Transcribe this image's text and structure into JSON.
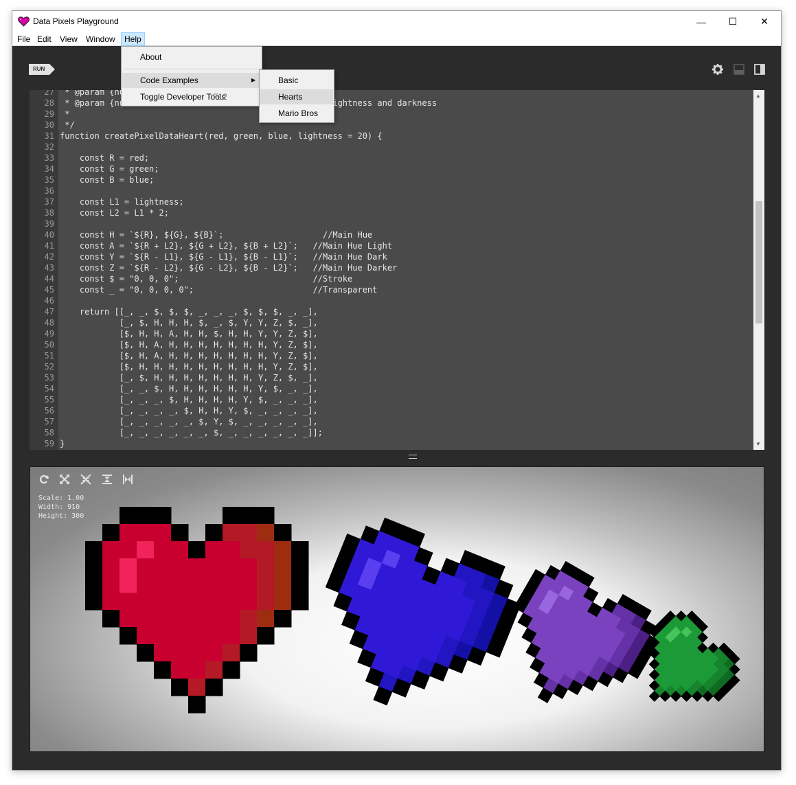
{
  "window": {
    "title": "Data Pixels Playground",
    "minimize": "—",
    "maximize": "☐",
    "close": "✕"
  },
  "menu": [
    {
      "label": "File"
    },
    {
      "label": "Edit"
    },
    {
      "label": "View"
    },
    {
      "label": "Window"
    },
    {
      "label": "Help"
    }
  ],
  "help_menu": {
    "about": "About",
    "code_examples": "Code Examples",
    "toggle_devtools": "Toggle Developer Tools",
    "devtools_shortcut": "F12"
  },
  "examples_submenu": [
    {
      "label": "Basic"
    },
    {
      "label": "Hearts"
    },
    {
      "label": "Mario Bros"
    }
  ],
  "toolbar": {
    "run_label": "RUN",
    "icons": [
      "run-icon",
      "gear-icon",
      "horizontal-layout-icon",
      "vertical-layout-icon"
    ]
  },
  "editor": {
    "lines": [
      {
        "n": "27",
        "text": " * @param {number} ...                           "
      },
      {
        "n": "28",
        "text": " * @param {nu                                    for brightness and darkness"
      },
      {
        "n": "29",
        "text": " *"
      },
      {
        "n": "30",
        "text": " */"
      },
      {
        "n": "31",
        "text": "function createPixelDataHeart(red, green, blue, lightness = 20) {"
      },
      {
        "n": "32",
        "text": ""
      },
      {
        "n": "33",
        "text": "    const R = red;"
      },
      {
        "n": "34",
        "text": "    const G = green;"
      },
      {
        "n": "35",
        "text": "    const B = blue;"
      },
      {
        "n": "36",
        "text": ""
      },
      {
        "n": "37",
        "text": "    const L1 = lightness;"
      },
      {
        "n": "38",
        "text": "    const L2 = L1 * 2;"
      },
      {
        "n": "39",
        "text": ""
      },
      {
        "n": "40",
        "text": "    const H = `${R}, ${G}, ${B}`;                    //Main Hue"
      },
      {
        "n": "41",
        "text": "    const A = `${R + L2}, ${G + L2}, ${B + L2}`;   //Main Hue Light"
      },
      {
        "n": "42",
        "text": "    const Y = `${R - L1}, ${G - L1}, ${B - L1}`;   //Main Hue Dark"
      },
      {
        "n": "43",
        "text": "    const Z = `${R - L2}, ${G - L2}, ${B - L2}`;   //Main Hue Darker"
      },
      {
        "n": "44",
        "text": "    const $ = \"0, 0, 0\";                           //Stroke"
      },
      {
        "n": "45",
        "text": "    const _ = \"0, 0, 0, 0\";                        //Transparent"
      },
      {
        "n": "46",
        "text": ""
      },
      {
        "n": "47",
        "text": "    return [[_, _, $, $, $, _, _, _, $, $, $, _, _],"
      },
      {
        "n": "48",
        "text": "            [_, $, H, H, H, $, _, $, Y, Y, Z, $, _],"
      },
      {
        "n": "49",
        "text": "            [$, H, H, A, H, H, $, H, H, Y, Y, Z, $],"
      },
      {
        "n": "50",
        "text": "            [$, H, A, H, H, H, H, H, H, H, Y, Z, $],"
      },
      {
        "n": "51",
        "text": "            [$, H, A, H, H, H, H, H, H, H, Y, Z, $],"
      },
      {
        "n": "52",
        "text": "            [$, H, H, H, H, H, H, H, H, H, Y, Z, $],"
      },
      {
        "n": "53",
        "text": "            [_, $, H, H, H, H, H, H, H, Y, Z, $, _],"
      },
      {
        "n": "54",
        "text": "            [_, _, $, H, H, H, H, H, H, Y, $, _, _],"
      },
      {
        "n": "55",
        "text": "            [_, _, _, $, H, H, H, H, Y, $, _, _, _],"
      },
      {
        "n": "56",
        "text": "            [_, _, _, _, $, H, H, Y, $, _, _, _, _],"
      },
      {
        "n": "57",
        "text": "            [_, _, _, _, _, $, Y, $, _, _, _, _, _],"
      },
      {
        "n": "58",
        "text": "            [_, _, _, _, _, _, $, _, _, _, _, _, _]];"
      },
      {
        "n": "59",
        "text": "}"
      }
    ]
  },
  "preview": {
    "icons": [
      "refresh-icon",
      "expand-icon",
      "contract-icon",
      "fit-height-icon",
      "fit-width-icon"
    ],
    "stats": {
      "scale": "Scale: 1.00",
      "width": "Width: 910",
      "height": "Height: 300"
    }
  },
  "hearts": [
    {
      "name": "red",
      "main": "#c8002f",
      "light": "#f0245a",
      "dark": "#b31a25",
      "darker": "#9e2d10"
    },
    {
      "name": "blue",
      "main": "#3019d6",
      "light": "#5a3ff0",
      "dark": "#2215c2",
      "darker": "#1410a6"
    },
    {
      "name": "purple",
      "main": "#7a42bf",
      "light": "#9a66e0",
      "dark": "#6431a6",
      "darker": "#4c1f85"
    },
    {
      "name": "green",
      "main": "#1c9a38",
      "light": "#47c35c",
      "dark": "#15842d",
      "darker": "#0f6a22"
    }
  ]
}
